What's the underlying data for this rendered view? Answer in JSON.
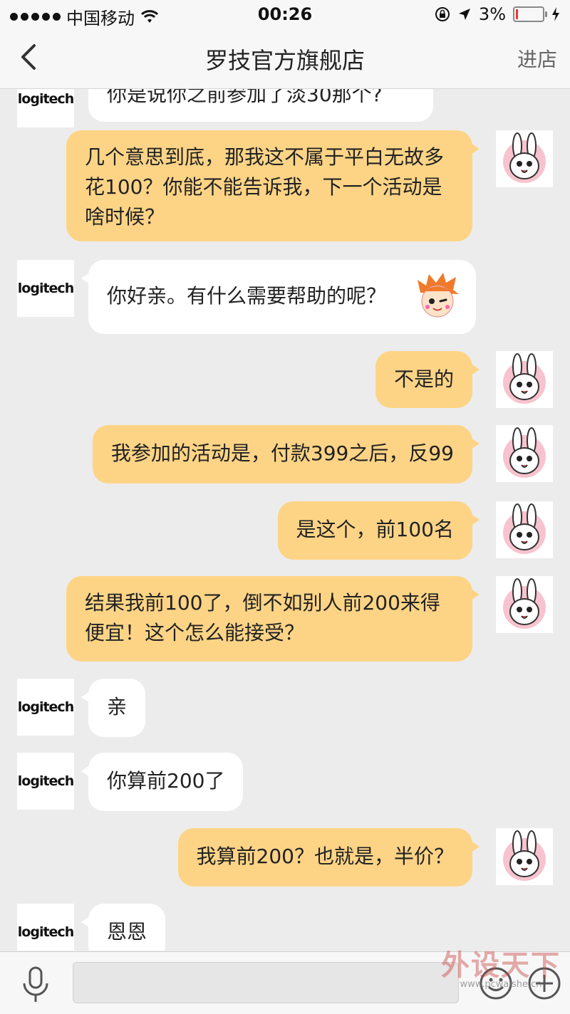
{
  "status_bar": {
    "carrier": "中国移动",
    "time": "00:26",
    "battery": "3%"
  },
  "nav": {
    "title": "罗技官方旗舰店",
    "enter_label": "进店"
  },
  "brand": {
    "logo_text": "logitech"
  },
  "messages": [
    {
      "side": "in",
      "text": "你是说你之前参加了淡30那个?"
    },
    {
      "side": "out",
      "text": "几个意思到底，那我这不属于平白无故多花100？你能不能告诉我，下一个活动是啥时候？"
    },
    {
      "side": "in",
      "text": "你好亲。有什么需要帮助的呢？",
      "emoji": "winking-boy-emoji"
    },
    {
      "side": "out",
      "text": "不是的"
    },
    {
      "side": "out",
      "text": "我参加的活动是，付款399之后，反99"
    },
    {
      "side": "out",
      "text": "是这个，前100名"
    },
    {
      "side": "out",
      "text": "结果我前100了，倒不如别人前200来得便宜！这个怎么能接受？"
    },
    {
      "side": "in",
      "text": "亲"
    },
    {
      "side": "in",
      "text": "你算前200了"
    },
    {
      "side": "out",
      "text": "我算前200？也就是，半价？"
    },
    {
      "side": "in",
      "text": "恩恩"
    }
  ],
  "input_bar": {
    "placeholder": "",
    "icons": [
      "microphone-icon",
      "emoji-icon",
      "plus-icon"
    ]
  },
  "watermark": {
    "text": "外设天下",
    "url": "www.pcwaishe.cn"
  }
}
